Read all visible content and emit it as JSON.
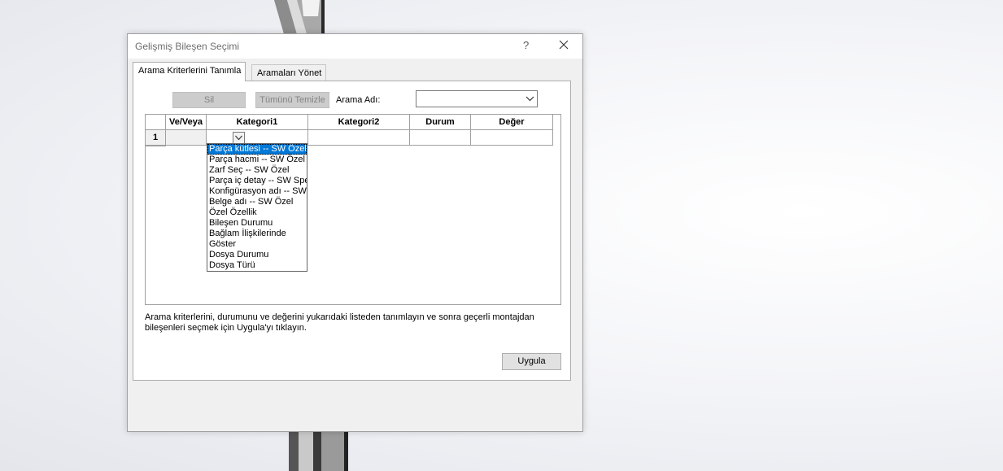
{
  "dialog": {
    "title": "Gelişmiş Bileşen Seçimi",
    "help_label": "?"
  },
  "tabs": [
    {
      "label": "Arama Kriterlerini Tanımla",
      "active": true
    },
    {
      "label": "Aramaları Yönet",
      "active": false
    }
  ],
  "toolbar": {
    "delete_label": "Sil",
    "clear_all_label": "Tümünü Temizle",
    "search_name_label": "Arama Adı:",
    "search_name_value": ""
  },
  "grid": {
    "columns": [
      "Ve/Veya",
      "Kategori1",
      "Kategori2",
      "Durum",
      "Değer"
    ],
    "rows": [
      {
        "number": "1",
        "and_or": "",
        "category1": "",
        "category2": "",
        "status": "",
        "value": ""
      }
    ]
  },
  "category_dropdown": {
    "selected_index": 0,
    "options": [
      "Parça kütlesi -- SW Özel",
      "Parça hacmi -- SW Özel",
      "Zarf Seç -- SW Özel",
      "Parça iç detay -- SW Spe",
      "Konfigürasyon adı -- SW",
      "Belge adı -- SW Özel",
      "Özel Özellik",
      "Bileşen Durumu",
      "Bağlam İlişkilerinde",
      "Göster",
      "Dosya Durumu",
      "Dosya Türü"
    ]
  },
  "info_text": "Arama kriterlerini, durumunu ve değerini yukarıdaki listeden tanımlayın ve sonra geçerli montajdan bileşenleri seçmek için Uygula'yı tıklayın.",
  "apply_label": "Uygula",
  "colors": {
    "selection": "#0078d7",
    "disabled_button": "#cccccc",
    "dialog_bg": "#f0f0f0"
  },
  "icons": [
    "close-icon",
    "chevron-down-icon"
  ]
}
